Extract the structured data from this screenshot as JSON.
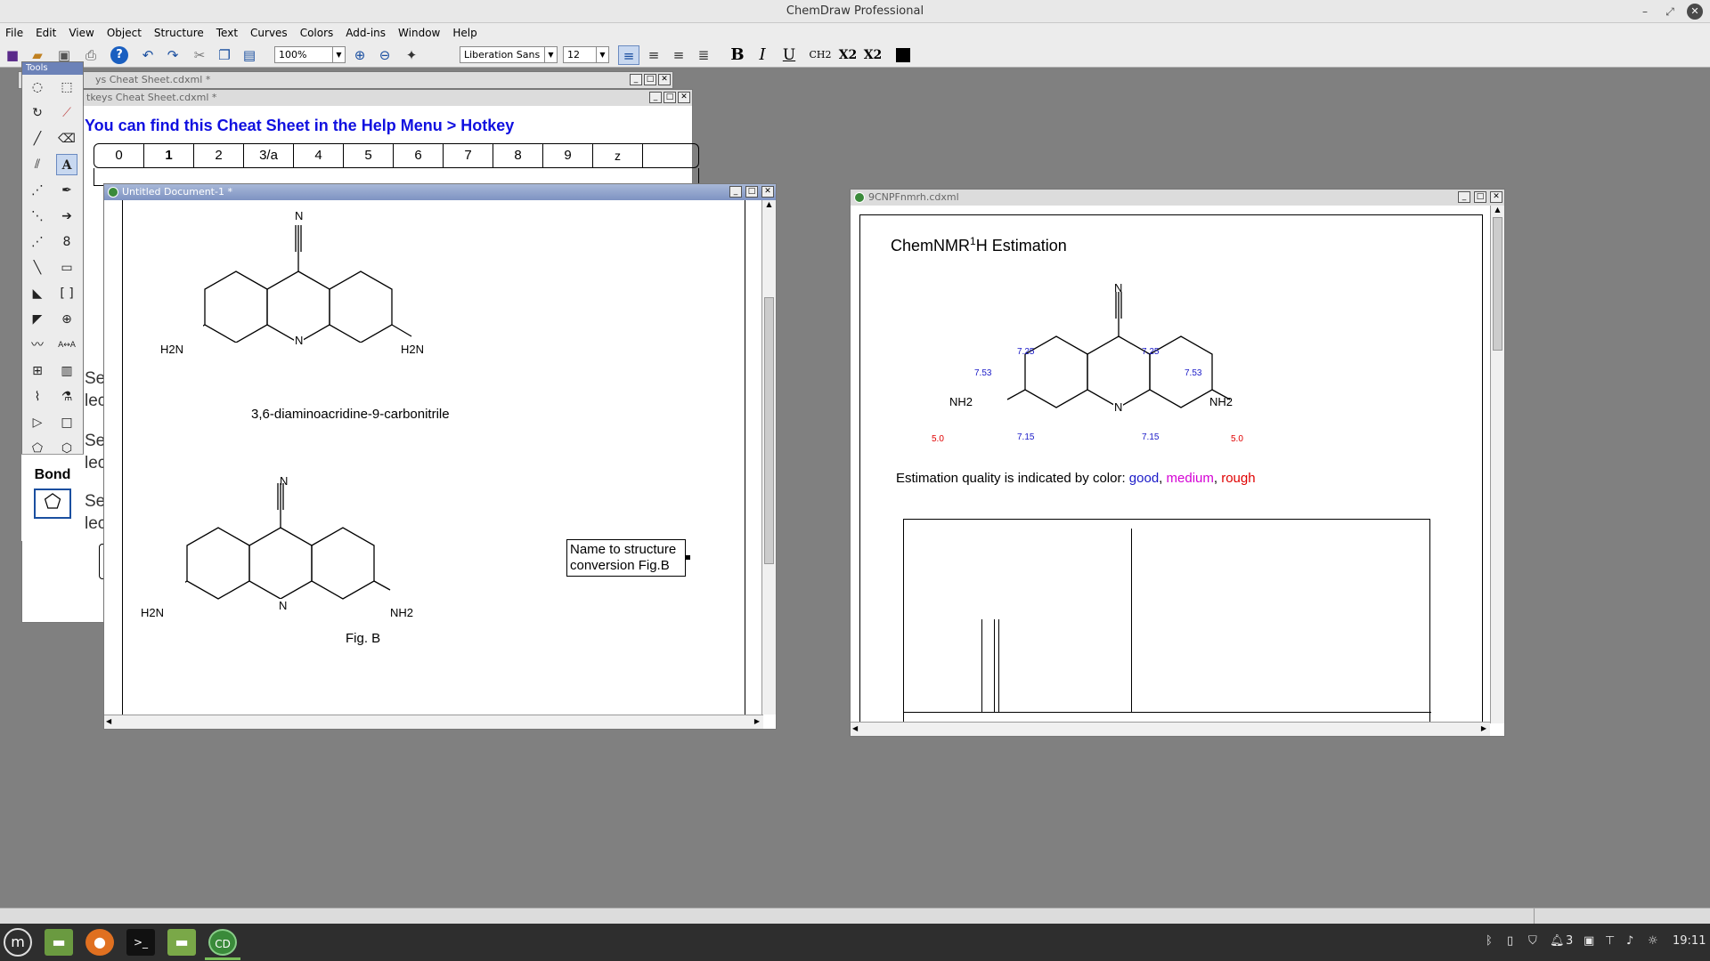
{
  "app": {
    "title": "ChemDraw Professional"
  },
  "menu": [
    "File",
    "Edit",
    "View",
    "Object",
    "Structure",
    "Text",
    "Curves",
    "Colors",
    "Add-ins",
    "Window",
    "Help"
  ],
  "toolbar": {
    "zoom": "100%",
    "font": "Liberation Sans",
    "size": "12",
    "bold": "B",
    "italic": "I",
    "underline": "U",
    "ch2": "CH2",
    "sub": "X2",
    "sup": "X2"
  },
  "tools_palette": {
    "title": "Tools",
    "bond_label": "Bond"
  },
  "cheat_sheet_back": {
    "title": "ys Cheat Sheet.cdxml *"
  },
  "cheat_sheet": {
    "title": "tkeys Cheat Sheet.cdxml *",
    "banner": "You can find this Cheat Sheet in the Help Menu > Hotkey",
    "keys": [
      "0",
      "1",
      "2",
      "3/a",
      "4",
      "5",
      "6",
      "7",
      "8",
      "9",
      "z"
    ],
    "side_text": [
      "Se",
      "lec",
      "Se",
      "lec",
      "Se",
      "lec"
    ]
  },
  "doc1": {
    "title": "Untitled Document-1 *",
    "molecule_name": "3,6-diaminoacridine-9-carbonitrile",
    "atoms": {
      "n_top": "N",
      "n_ring": "N",
      "nh2": "H2N",
      "nh2_right": "H2N",
      "fig_nh2_left": "H2N",
      "fig_nh2_right": "NH2"
    },
    "fig_label": "Fig. B",
    "textbox_line1": "Name to structure",
    "textbox_line2": "conversion  Fig.B"
  },
  "doc2": {
    "title": "9CNPFnmrh.cdxml",
    "heading_prefix": "ChemNMR",
    "heading_sup": "1",
    "heading_suffix": "H Estimation",
    "shifts": {
      "a": "7.25",
      "b": "7.25",
      "c": "7.53",
      "d": "7.53",
      "e": "7.15",
      "f": "7.15",
      "nh_l": "5.0",
      "nh_r": "5.0"
    },
    "atoms": {
      "n_top": "N",
      "n_ring": "N",
      "nh2_left": "NH2",
      "nh2_right": "NH2"
    },
    "quality_prefix": "Estimation quality is indicated by color: ",
    "quality_good": "good",
    "quality_medium": "medium",
    "quality_rough": "rough",
    "colors": {
      "good": "#1a1ac8",
      "medium": "#d400d4",
      "rough": "#e00000"
    }
  },
  "taskbar": {
    "clock": "19:11",
    "workspace": "3"
  }
}
